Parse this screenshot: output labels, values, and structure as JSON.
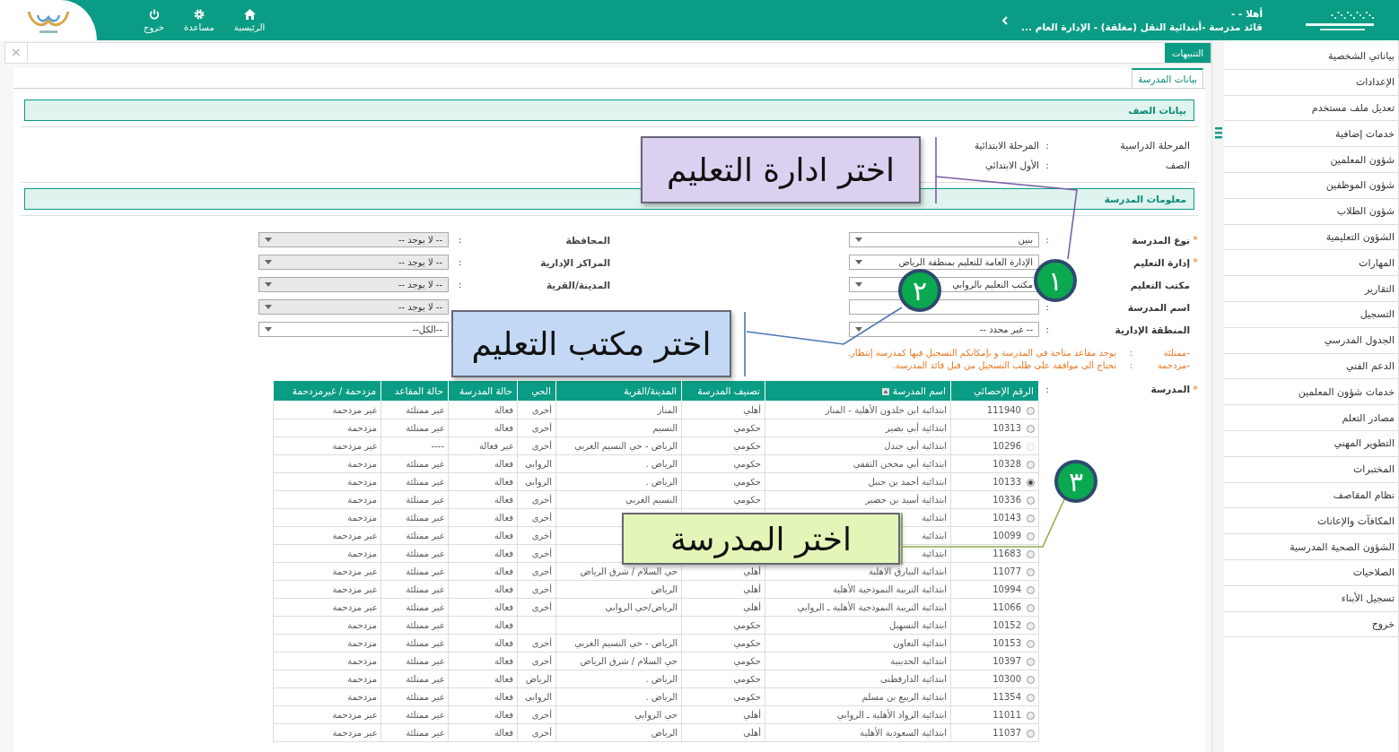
{
  "top_bar": {
    "greeting": "أهلا - -",
    "user_role": "قائد مدرسة -أبتدائية النقل (مغلقة) - الإدارة العام ...",
    "nav": [
      {
        "label": "الرئيسية",
        "kind": "home"
      },
      {
        "label": "مساعدة",
        "kind": "help"
      },
      {
        "label": "خروج",
        "kind": "logout"
      }
    ]
  },
  "sidebar": {
    "items": [
      {
        "label": "بياناتي الشخصية"
      },
      {
        "label": "الإعدادات"
      },
      {
        "label": "تعديل ملف مستخدم"
      },
      {
        "label": "خدمات إضافية"
      },
      {
        "label": "شؤون المعلمين"
      },
      {
        "label": "شؤون الموظفين"
      },
      {
        "label": "شؤون الطلاب"
      },
      {
        "label": "الشؤون التعليمية"
      },
      {
        "label": "المهارات"
      },
      {
        "label": "التقارير"
      },
      {
        "label": "التسجيل"
      },
      {
        "label": "الجدول المدرسي"
      },
      {
        "label": "الدعم الفني"
      },
      {
        "label": "خدمات شؤون المعلمين"
      },
      {
        "label": "مصادر التعلم"
      },
      {
        "label": "التطوير المهني"
      },
      {
        "label": "المختبرات"
      },
      {
        "label": "نظام المقاصف"
      },
      {
        "label": "المكافآت والإعانات"
      },
      {
        "label": "الشؤون الصحية المدرسية"
      },
      {
        "label": "الصلاحيات"
      },
      {
        "label": "تسجيل الأبناء"
      },
      {
        "label": "خروج"
      }
    ]
  },
  "alerts_tab": "التنبيهات",
  "close_icon": "×",
  "page_tab": "بيانات المدرسة",
  "class_section": {
    "title": "بيانات الصف",
    "fields": [
      {
        "label": "المرحلة الدراسية",
        "colon": ":",
        "value": "المرحلة الابتدائية"
      },
      {
        "label": "الصف",
        "colon": ":",
        "value": "الأول الابتدائي"
      }
    ]
  },
  "school_section": {
    "title": "معلومات المدرسة",
    "right_fields": [
      {
        "required_mark": "*",
        "label": "نوع المدرسة",
        "colon": ":",
        "kind": "select",
        "value": "بنين"
      },
      {
        "required_mark": "*",
        "label": "إدارة التعليم",
        "kind": "select",
        "value": "الإدارة العامة للتعليم بمنطقة الرياض"
      },
      {
        "label": "مكتب التعليم",
        "kind": "select",
        "value": "مكتب التعليم بالروابي"
      },
      {
        "label": "اسم المدرسة",
        "colon": ":",
        "kind": "input"
      },
      {
        "label": "المنطقة الإدارية",
        "colon": ":",
        "kind": "select",
        "value": "-- غير محدد --"
      }
    ],
    "left_fields": [
      {
        "label": "المحافظة",
        "colon": ":",
        "kind": "select",
        "disabled": true,
        "value": "-- لا يوجد --"
      },
      {
        "label": "المراكز الإدارية",
        "colon": ":",
        "kind": "select",
        "disabled": true,
        "value": "-- لا يوجد --"
      },
      {
        "label": "المدينة/القرية",
        "colon": ":",
        "kind": "select",
        "disabled": true,
        "value": "-- لا يوجد --"
      },
      {
        "kind": "select",
        "disabled": true,
        "value": "-- لا يوجد --"
      },
      {
        "kind": "select",
        "disabled": false,
        "value": "--الكل--"
      }
    ],
    "legend": [
      {
        "term": "-ممتلئة",
        "colon": ":",
        "text": "يوجد مقاعد متاحة في المدرسة و بإمكانكم التسجيل فيها كمدرسة إنتظار."
      },
      {
        "term": "-مزدحمة",
        "colon": ":",
        "text": "تحتاج الى موافقة على طلب التسجيل من قبل قائد المدرسة."
      }
    ],
    "school_required_mark": "*",
    "school_label": "المدرسة",
    "school_colon": ":"
  },
  "table": {
    "columns": [
      "الرقم الإحصائي",
      "اسم المدرسة",
      "تصنيف المدرسة",
      "المدينة/القرية",
      "الحي",
      "حالة المدرسة",
      "حالة المقاعد",
      "مزدحمة / غيرمزدحمة"
    ],
    "rows": [
      {
        "selected": false,
        "disabled": false,
        "number": "111940",
        "name": "ابتدائية ابن خلدون الأهلية - المنار",
        "type": "أهلي",
        "city": "المنار",
        "district": "أخرى",
        "status": "فعالة",
        "seats": "غير ممتلئة",
        "crowding": "غير مزدحمة"
      },
      {
        "selected": false,
        "disabled": false,
        "number": "10313",
        "name": "ابتدائية أبي بصير",
        "type": "حكومي",
        "city": "النسيم",
        "district": "أخرى",
        "status": "فعالة",
        "seats": "غير ممتلئة",
        "crowding": "مزدحمة"
      },
      {
        "selected": false,
        "disabled": true,
        "number": "10296",
        "name": "ابتدائية أبي جندل",
        "type": "حكومي",
        "city": "الرياض - حي النسيم الغربي",
        "district": "أخرى",
        "status": "غير فعالة",
        "seats": "----",
        "crowding": "غير مزدحمة"
      },
      {
        "selected": false,
        "disabled": false,
        "number": "10328",
        "name": "ابتدائية أبي محجن الثقفي",
        "type": "حكومي",
        "city": "الرياض .",
        "district": "الروابي",
        "status": "فعالة",
        "seats": "غير ممتلئة",
        "crowding": "مزدحمة"
      },
      {
        "selected": true,
        "disabled": false,
        "number": "10133",
        "name": "ابتدائية أحمد بن حنبل",
        "type": "حكومي",
        "city": "الرياض .",
        "district": "الروابى",
        "status": "فعالة",
        "seats": "غير ممتلئة",
        "crowding": "مزدحمة"
      },
      {
        "selected": false,
        "disabled": false,
        "number": "10336",
        "name": "ابتدائية أسيد بن حضير",
        "type": "حكومي",
        "city": "النسيم الغربي",
        "district": "أخرى",
        "status": "فعالة",
        "seats": "غير ممتلئة",
        "crowding": "مزدحمة"
      },
      {
        "selected": false,
        "disabled": false,
        "number": "10143",
        "name": "ابتدائية",
        "district": "أخرى",
        "status": "فعالة",
        "seats": "غير ممتلئة",
        "crowding": "مزدحمة"
      },
      {
        "selected": false,
        "disabled": false,
        "number": "10099",
        "name": "ابتدائية",
        "district": "أخرى",
        "status": "فعالة",
        "seats": "غير ممتلئة",
        "crowding": "غير مزدحمة"
      },
      {
        "selected": false,
        "disabled": false,
        "number": "11683",
        "name": "ابتدائية",
        "district": "أخرى",
        "status": "فعالة",
        "seats": "غير ممتلئة",
        "crowding": "مزدحمة"
      },
      {
        "selected": false,
        "disabled": false,
        "number": "11077",
        "name": "ابتدائية البيارق الاهلية",
        "type": "أهلي",
        "city": "حي السلام / شرق الرياض",
        "district": "أخرى",
        "status": "فعالة",
        "seats": "غير ممتلئة",
        "crowding": "غير مزدحمة"
      },
      {
        "selected": false,
        "disabled": false,
        "number": "10994",
        "name": "ابتدائية التربية النموذجية الأهلية",
        "type": "أهلي",
        "city": "الرياض",
        "district": "أخرى",
        "status": "فعالة",
        "seats": "غير ممتلئة",
        "crowding": "غير مزدحمة"
      },
      {
        "selected": false,
        "disabled": false,
        "number": "11066",
        "name": "ابتدائية التربية النموذجية الأهلية ـ الروابي",
        "type": "أهلي",
        "city": "الرياض/حي الروابي",
        "district": "أخرى",
        "status": "فعالة",
        "seats": "غير ممتلئة",
        "crowding": "غير مزدحمة"
      },
      {
        "selected": false,
        "disabled": false,
        "number": "10152",
        "name": "ابتدائية التسهيل",
        "type": "حكومي",
        "status": "فعالة",
        "seats": "غير ممتلئة",
        "crowding": "مزدحمة"
      },
      {
        "selected": false,
        "disabled": false,
        "number": "10153",
        "name": "ابتدائية التعاون",
        "type": "حكومي",
        "city": "الرياض - حي النسيم الغربي",
        "district": "أخرى",
        "status": "فعالة",
        "seats": "غير ممتلئة",
        "crowding": "مزدحمة"
      },
      {
        "selected": false,
        "disabled": false,
        "number": "10397",
        "name": "ابتدائية الحديبية",
        "type": "حكومي",
        "city": "حي السلام / شرق الرياض",
        "district": "أخرى",
        "status": "فعالة",
        "seats": "غير ممتلئة",
        "crowding": "مزدحمة"
      },
      {
        "selected": false,
        "disabled": false,
        "number": "10300",
        "name": "ابتدائية الدارقطنى",
        "type": "حكومي",
        "city": "الرياض .",
        "district": "الرياض",
        "status": "فعالة",
        "seats": "غير ممتلئة",
        "crowding": "مزدحمة"
      },
      {
        "selected": false,
        "disabled": false,
        "number": "11354",
        "name": "ابتدائية الربيع بن مسلم",
        "type": "حكومي",
        "city": "الرياض .",
        "district": "الروابى",
        "status": "فعالة",
        "seats": "غير ممتلئة",
        "crowding": "مزدحمة"
      },
      {
        "selected": false,
        "disabled": false,
        "number": "11011",
        "name": "ابتدائية الرواد الأهلية ـ الروابي",
        "type": "أهلي",
        "city": "حي الروابي",
        "district": "أخرى",
        "status": "فعالة",
        "seats": "غير ممتلئة",
        "crowding": "غير مزدحمة"
      },
      {
        "selected": false,
        "disabled": false,
        "number": "11037",
        "name": "ابتدائية السعودية الأهلية",
        "type": "أهلي",
        "city": "الرياض",
        "district": "أخرى",
        "status": "فعالة",
        "seats": "غير ممتلئة",
        "crowding": "غير مزدحمة"
      }
    ]
  },
  "callouts": [
    {
      "text": "اختر ادارة التعليم",
      "step": "١",
      "color": "#dcd0f0"
    },
    {
      "text": "اختر مكتب التعليم",
      "step": "٢",
      "color": "#c3d8f5"
    },
    {
      "text": "اختر المدرسة",
      "step": "٣",
      "color": "#e4f5b8"
    }
  ]
}
